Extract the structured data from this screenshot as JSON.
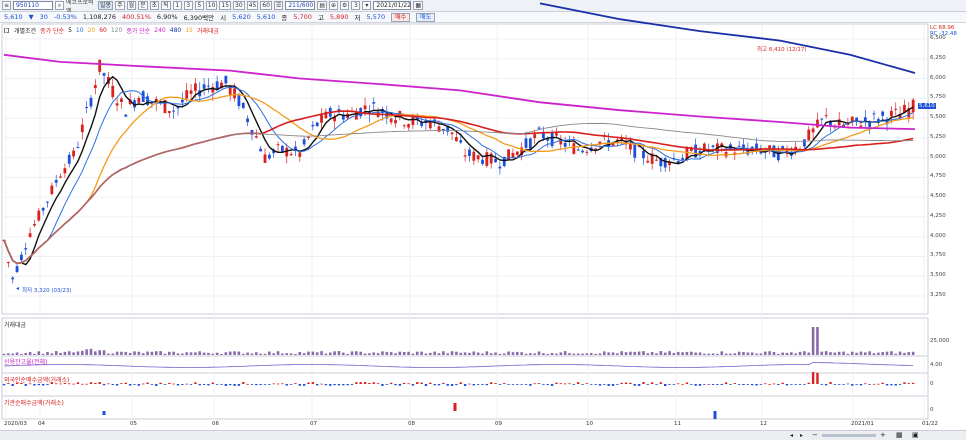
{
  "toolbar": {
    "code": "950110",
    "name": "에코프로비엠",
    "chart_type": "일봉",
    "periods": [
      "주",
      "월",
      "분",
      "초",
      "틱"
    ],
    "intervals": [
      "1",
      "3",
      "5",
      "10",
      "15",
      "30",
      "45",
      "60"
    ],
    "count": "211/600",
    "date": "2021/01/22"
  },
  "quote": {
    "price": "5,610",
    "change": "30",
    "rate": "-0.53%",
    "volume": "1,108,276",
    "vol_rate": "400.51%",
    "turnover_rate": "6.90%",
    "amount": "6,390백만",
    "open_label": "시",
    "open": "5,620",
    "cur2": "5,610",
    "high_label": "고",
    "high": "5,890",
    "low_label": "저",
    "low": "5,570",
    "prev_close_label": "종",
    "prev_close": "5,700",
    "buy_label": "매수",
    "sell_label": "매도"
  },
  "legend_main": {
    "checkbox_label": "개별조건",
    "ma_label_a": "종가 단순",
    "ma_vals_a": [
      "5",
      "10",
      "20",
      "60",
      "120"
    ],
    "ma_label_b": "종가 단순",
    "ma_vals_b": [
      "240",
      "480",
      "15"
    ],
    "volume_label": "거래대금"
  },
  "annotations": {
    "high": "최고 6,410 (12/17)",
    "low": "최저 3,320 (03/23)",
    "top_right_a": "LC 68.96",
    "top_right_b": "RC -32.48"
  },
  "price_axis": [
    "6,500",
    "6,250",
    "6,000",
    "5,750",
    "5,500",
    "5,250",
    "5,000",
    "4,750",
    "4,500",
    "4,250",
    "4,000",
    "3,750",
    "3,500",
    "3,250"
  ],
  "price_tag": "5,610",
  "panels": {
    "volume": {
      "label": "거래대금",
      "axis": "25,000"
    },
    "credit": {
      "label": "신용잔고율(전체)",
      "axis": "4.00"
    },
    "foreign": {
      "label": "외국인순매수금액(거래소)",
      "axis": "0"
    },
    "institution": {
      "label": "기관순매수금액(거래소)",
      "axis": "0"
    }
  },
  "x_axis": [
    "2020/03",
    "04",
    "05",
    "06",
    "07",
    "08",
    "09",
    "10",
    "11",
    "12",
    "2021/01",
    "01/22"
  ],
  "colors": {
    "up": "#d9211f",
    "down": "#1e4fd8",
    "ma5": "#111111",
    "ma10": "#2d6fe0",
    "ma20": "#f39c1a",
    "ma60": "#d6201e",
    "ma120": "#888888",
    "ma240": "#cc22cc",
    "ma480": "#1a2fa8"
  }
}
